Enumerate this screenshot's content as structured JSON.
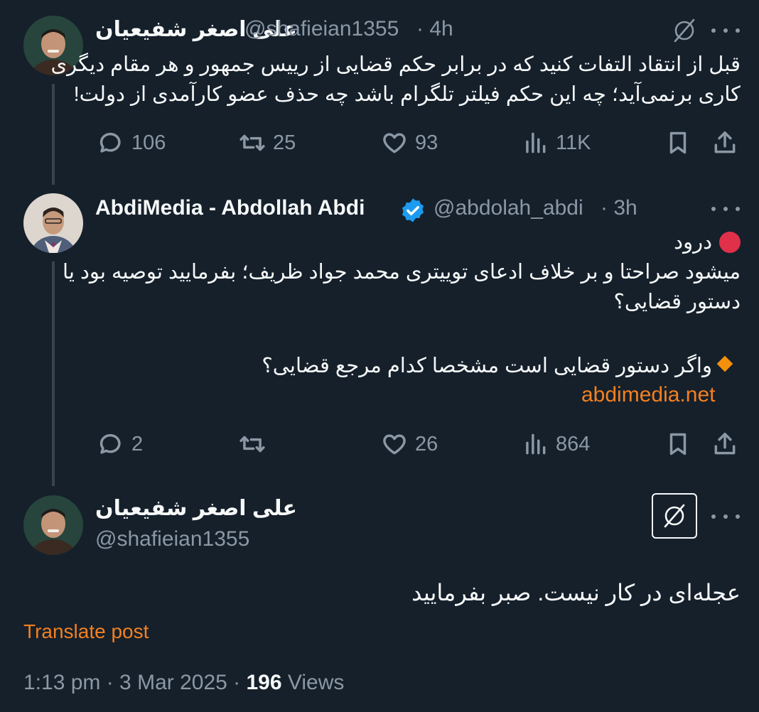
{
  "tweet1": {
    "name": "علی اصغر شفیعیان",
    "handle": "@shafieian1355",
    "time": "· 4h",
    "text_line1": "قبل از انتقاد التفات کنید که در برابر حکم قضایی از رییس جمهور و هر مقام دیگری",
    "text_line2": "کاری برنمی‌آید؛ چه این حکم فیلتر تلگرام باشد چه حذف عضو کارآمدی از دولت!",
    "replies": "106",
    "reposts": "25",
    "likes": "93",
    "views": "11K"
  },
  "tweet2": {
    "name": "AbdiMedia - Abdollah Abdi",
    "handle": "@abdolah_abdi",
    "time": "· 3h",
    "line1": "درود",
    "line2": "میشود صراحتا و بر خلاف ادعای توییتری محمد جواد ظریف؛ بفرمایید توصیه بود یا",
    "line3": "دستور قضایی؟",
    "line4": "واگر دستور قضایی است مشخصا کدام مرجع قضایی؟",
    "link": "abdimedia.net",
    "replies": "2",
    "reposts": "",
    "likes": "26",
    "views": "864"
  },
  "tweet3": {
    "name": "علی اصغر شفیعیان",
    "handle": "@shafieian1355",
    "text": "عجله‌ای در کار نیست. صبر بفرمایید",
    "translate": "Translate post",
    "time_date": "1:13 pm · 3 Mar 2025 ·",
    "views_count": "196",
    "views_label": "Views"
  },
  "colors": {
    "background": "#15202b",
    "accent_link": "#f4801f",
    "verified": "#1d9bf0",
    "muted": "#8b98a5"
  },
  "icons": [
    "grok-icon",
    "more-icon",
    "reply-icon",
    "repost-icon",
    "like-icon",
    "views-icon",
    "bookmark-icon",
    "share-icon",
    "verified-badge-icon",
    "red-circle-icon",
    "orange-diamond-icon"
  ]
}
